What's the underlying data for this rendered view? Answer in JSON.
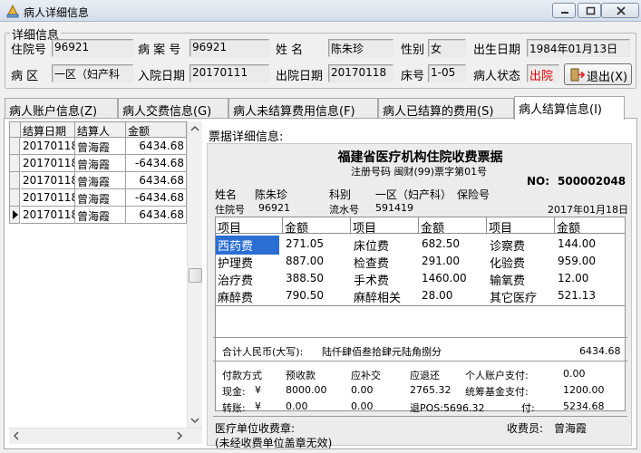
{
  "window": {
    "title": "病人详细信息"
  },
  "group": {
    "legend": "详细信息"
  },
  "patient": {
    "admission_no_label": "住院号",
    "admission_no": "96921",
    "case_no_label": "病 案 号",
    "case_no": "96921",
    "name_label": "姓    名",
    "name": "陈朱珍",
    "sex_label": "性别",
    "sex": "女",
    "birth_label": "出生日期",
    "birth": "1984年01月13日",
    "ward_label": "病   区",
    "ward": "一区（妇产科",
    "admit_date_label": "入院日期",
    "admit_date": "20170111",
    "discharge_date_label": "出院日期",
    "discharge_date": "20170118",
    "bed_label": "床号",
    "bed": "1-05",
    "status_label": "病人状态",
    "status": "出院"
  },
  "exit_label": "退出(X)",
  "tabs": [
    {
      "label": "病人账户信息(Z)"
    },
    {
      "label": "病人交费信息(G)"
    },
    {
      "label": "病人未结算费用信息(F)"
    },
    {
      "label": "病人已结算的费用(S)"
    },
    {
      "label": "病人结算信息(I)"
    }
  ],
  "grid": {
    "headers": [
      "结算日期",
      "结算人",
      "金额"
    ],
    "rows": [
      [
        "20170118",
        "曾海霞",
        "6434.68"
      ],
      [
        "20170118",
        "曾海霞",
        "-6434.68"
      ],
      [
        "20170118",
        "曾海霞",
        "6434.68"
      ],
      [
        "20170118",
        "曾海霞",
        "-6434.68"
      ],
      [
        "20170118",
        "曾海霞",
        "6434.68"
      ]
    ]
  },
  "receipt": {
    "section_label": "票据详细信息:",
    "title": "福建省医疗机构住院收费票据",
    "subtitle": "注册号码 闽财(99)票字第01号",
    "no_label": "NO:",
    "no": "500002048",
    "name_label": "姓名",
    "name": "陈朱珍",
    "dept_label": "科别",
    "dept": "一区（妇产科）",
    "insurance_label": "保险号",
    "admission_label": "住院号",
    "admission": "96921",
    "serial_label": "流水号",
    "serial": "591419",
    "date": "2017年01月18日",
    "fee_headers": [
      "项目",
      "金额",
      "项目",
      "金额",
      "项目",
      "金额"
    ],
    "fee_rows": [
      [
        "西药费",
        "271.05",
        "床位费",
        "682.50",
        "诊察费",
        "144.00"
      ],
      [
        "护理费",
        "887.00",
        "检查费",
        "291.00",
        "化验费",
        "959.00"
      ],
      [
        "治疗费",
        "388.50",
        "手术费",
        "1460.00",
        "输氧费",
        "12.00"
      ],
      [
        "麻醉费",
        "790.50",
        "麻醉相关",
        "28.00",
        "其它医疗",
        "521.13"
      ]
    ],
    "total_label": "合计人民币(大写):",
    "total_words": "陆仟肆佰叁拾肆元陆角捌分",
    "total": "6434.68",
    "pay_method_label": "付款方式",
    "prepaid_label": "预收款",
    "should_pay_label": "应补交",
    "should_refund_label": "应退还",
    "personal_account_label": "个人账户支付:",
    "personal_account": "0.00",
    "cash_label": "现金:",
    "cash_symbol": "¥",
    "cash_prepaid": "8000.00",
    "cash_pay": "0.00",
    "cash_refund": "2765.32",
    "fund_label": "统筹基金支付:",
    "fund": "1200.00",
    "transfer_label": "转账:",
    "transfer_symbol": "¥",
    "transfer_prepaid": "0.00",
    "transfer_pay": "0.00",
    "pos_refund": "退POS:5696.32",
    "paid_label": "付:",
    "paid": "5234.68",
    "unit_seal_label": "医疗单位收费章:",
    "cashier_label": "收费员:",
    "cashier": "曾海霞",
    "note": "(未经收费单位盖章无效)"
  }
}
